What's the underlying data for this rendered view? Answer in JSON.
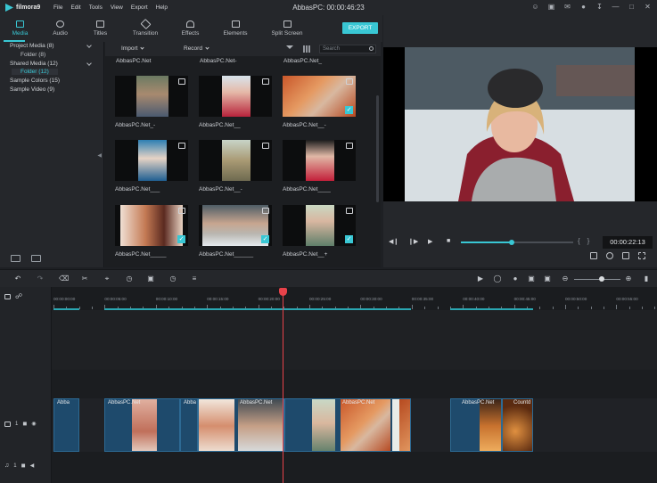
{
  "app": {
    "logo": "filmora9",
    "menu": [
      "File",
      "Edit",
      "Tools",
      "View",
      "Export",
      "Help"
    ],
    "window_title": "AbbasPC:  00:00:46:23",
    "title_icons": [
      "user-icon",
      "gift-icon",
      "mail-icon",
      "bulb-icon",
      "download-icon",
      "minimize-icon",
      "restore-icon",
      "close-icon"
    ]
  },
  "module_tabs": [
    {
      "label": "Media",
      "icon": "folder-icon",
      "active": true
    },
    {
      "label": "Audio",
      "icon": "music-note-icon",
      "active": false
    },
    {
      "label": "Titles",
      "icon": "text-icon",
      "active": false
    },
    {
      "label": "Transition",
      "icon": "transition-icon",
      "active": false
    },
    {
      "label": "Effects",
      "icon": "effects-icon",
      "active": false
    },
    {
      "label": "Elements",
      "icon": "image-icon",
      "active": false
    },
    {
      "label": "Split Screen",
      "icon": "split-screen-icon",
      "active": false
    }
  ],
  "export_label": "EXPORT",
  "library": {
    "items": [
      {
        "label": "Project Media (8)",
        "level": 0,
        "expandable": true
      },
      {
        "label": "Folder (8)",
        "level": 1,
        "expandable": false
      },
      {
        "label": "Shared Media (12)",
        "level": 0,
        "expandable": true
      },
      {
        "label": "Folder (12)",
        "level": 1,
        "expandable": false,
        "selected": true
      },
      {
        "label": "Sample Colors (15)",
        "level": 0,
        "expandable": false
      },
      {
        "label": "Sample Video (9)",
        "level": 0,
        "expandable": false
      }
    ]
  },
  "browser": {
    "import_label": "Import",
    "record_label": "Record",
    "search_placeholder": "Search",
    "top_labels": [
      "AbbasPC.Net",
      "AbbasPC.Net-",
      "AbbasPC.Net_"
    ],
    "clips": [
      {
        "label": "AbbasPC.Net_-",
        "checked": false
      },
      {
        "label": "AbbasPC.Net__",
        "checked": false
      },
      {
        "label": "AbbasPC.Net__-",
        "checked": true
      },
      {
        "label": "AbbasPC.Net___",
        "checked": false
      },
      {
        "label": "AbbasPC.Net__-",
        "checked": false
      },
      {
        "label": "AbbasPC.Net____",
        "checked": false
      },
      {
        "label": "AbbasPC.Net_____",
        "checked": true
      },
      {
        "label": "AbbasPC.Net______",
        "checked": true
      },
      {
        "label": "AbbasPC.Net__+",
        "checked": true
      }
    ]
  },
  "player": {
    "timecode": "00:00:22:13",
    "progress_fraction": 0.45,
    "controls": [
      "prev-frame-icon",
      "play-slow-icon",
      "play-icon",
      "stop-icon"
    ],
    "tools": [
      "render-icon",
      "snapshot-icon",
      "volume-icon",
      "fullscreen-icon"
    ]
  },
  "timeline": {
    "ruler_labels": [
      "00:00:00:00",
      "00:00:05:00",
      "00:00:10:00",
      "00:00:15:00",
      "00:00:20:00",
      "00:00:25:00",
      "00:00:30:00",
      "00:00:35:00",
      "00:00:40:00",
      "00:00:45:00",
      "00:00:50:00",
      "00:00:55:00"
    ],
    "toolbar_left": [
      "undo-icon",
      "redo-icon",
      "delete-icon",
      "cut-icon",
      "crop-icon",
      "speed-icon",
      "green-screen-icon",
      "duration-icon",
      "audio-mixer-icon"
    ],
    "toolbar_right": [
      "render-preview-icon",
      "marker-icon",
      "voiceover-icon",
      "mixer-icon",
      "snapshot-icon",
      "zoom-out-icon",
      "zoom-in-icon",
      "layout-icon"
    ],
    "zoom_fraction": 0.6,
    "video_track": {
      "label": "1",
      "clips": [
        "Abba",
        "AbbasPC.Net",
        "Abba",
        "AbbasPC.Net",
        "AbbasPC.Net",
        "AbbasPC.Net",
        "Countd"
      ]
    },
    "audio_track": {
      "label": "1"
    }
  },
  "colors": {
    "accent": "#39c7d4",
    "playhead": "#e8424a",
    "clip": "#1e4a6c"
  }
}
